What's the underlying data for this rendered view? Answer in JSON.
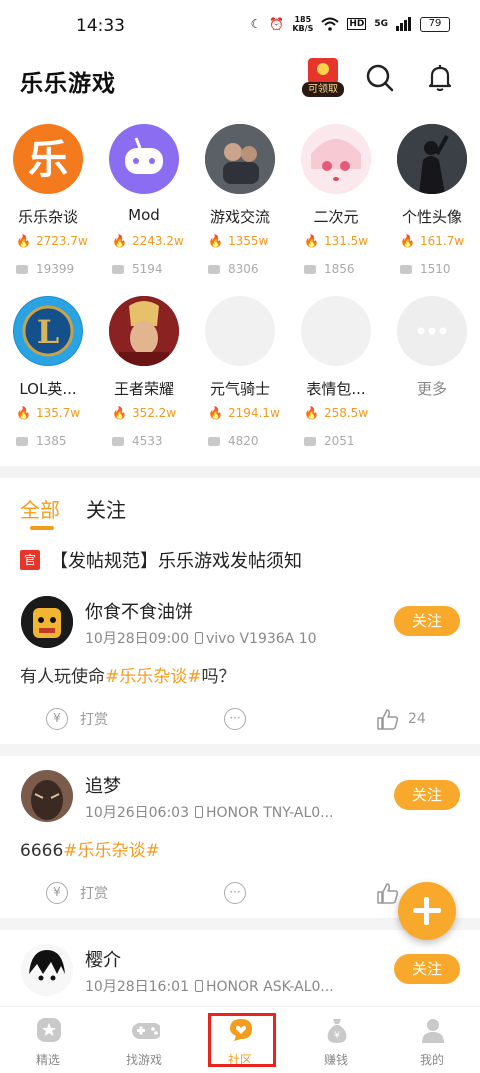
{
  "status_bar": {
    "time": "14:33",
    "net_speed_value": "185",
    "net_speed_unit": "KB/S",
    "hd": "HD",
    "signal": "5G",
    "battery": "79"
  },
  "header": {
    "title": "乐乐游戏",
    "redpacket_label": "可领取"
  },
  "colors": {
    "accent": "#f59c1d",
    "follow_bg": "#f8a92b",
    "red": "#e8352b"
  },
  "categories": [
    {
      "name": "乐乐杂谈",
      "hot": "2723.7w",
      "comments": "19399"
    },
    {
      "name": "Mod",
      "hot": "2243.2w",
      "comments": "5194"
    },
    {
      "name": "游戏交流",
      "hot": "1355w",
      "comments": "8306"
    },
    {
      "name": "二次元",
      "hot": "131.5w",
      "comments": "1856"
    },
    {
      "name": "个性头像",
      "hot": "161.7w",
      "comments": "1510"
    },
    {
      "name": "LOL英...",
      "hot": "135.7w",
      "comments": "1385"
    },
    {
      "name": "王者荣耀",
      "hot": "352.2w",
      "comments": "4533"
    },
    {
      "name": "元气骑士",
      "hot": "2194.1w",
      "comments": "4820"
    },
    {
      "name": "表情包...",
      "hot": "258.5w",
      "comments": "2051"
    },
    {
      "name": "更多"
    }
  ],
  "feed_tabs": [
    "全部",
    "关注"
  ],
  "notice": {
    "tag": "官",
    "text": "【发帖规范】乐乐游戏发帖须知"
  },
  "posts": [
    {
      "user": "你食不食油饼",
      "date": "10月28日09:00",
      "device": "vivo V1936A 10",
      "follow": "关注",
      "text_prefix": "有人玩使命",
      "topic": "#乐乐杂谈#",
      "text_suffix": "吗？",
      "reward": "打赏",
      "likes": "24"
    },
    {
      "user": "追梦",
      "date": "10月26日06:03",
      "device": "HONOR TNY-AL0...",
      "follow": "关注",
      "text_prefix": "6666",
      "topic": "#乐乐杂谈#",
      "text_suffix": "",
      "reward": "打赏",
      "likes": ""
    },
    {
      "user": "樱介",
      "date": "10月28日16:01",
      "device": "HONOR ASK-AL0...",
      "follow": "关注"
    }
  ],
  "tabbar": [
    {
      "label": "精选",
      "icon": "star-icon"
    },
    {
      "label": "找游戏",
      "icon": "gamepad-icon"
    },
    {
      "label": "社区",
      "icon": "community-heart-icon",
      "active": true
    },
    {
      "label": "赚钱",
      "icon": "money-bag-icon"
    },
    {
      "label": "我的",
      "icon": "person-icon"
    }
  ]
}
